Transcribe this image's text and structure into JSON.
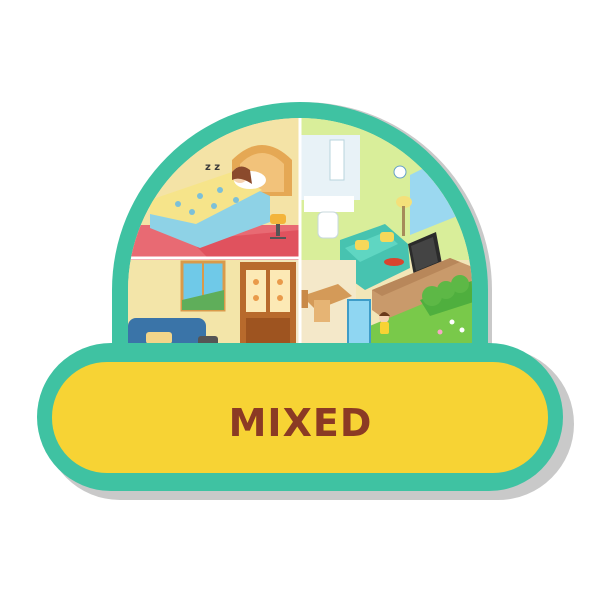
{
  "level_button": {
    "label": "MIXED"
  },
  "colors": {
    "frame_teal": "#3FC2A2",
    "frame_shadow": "#C9C9C9",
    "frame_inner_white": "#FFFFFF",
    "label_yellow": "#F7D334",
    "label_text": "#8B3A24"
  },
  "illustration": {
    "scenes": [
      "bedroom",
      "bathroom",
      "living-room",
      "kitchen",
      "dining-room",
      "garden"
    ]
  }
}
